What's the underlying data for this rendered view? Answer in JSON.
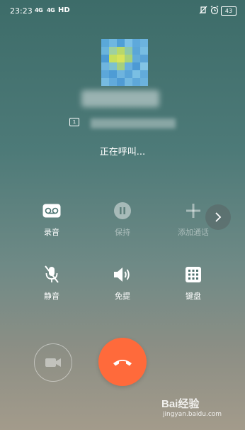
{
  "status_bar": {
    "time": "23:23",
    "signal_1": "4G",
    "signal_2": "4G",
    "network_type": "HD",
    "battery": "43"
  },
  "contact": {
    "sim_slot": "1"
  },
  "call": {
    "status_text": "正在呼叫..."
  },
  "controls": {
    "record_label": "录音",
    "hold_label": "保持",
    "add_call_label": "添加通话",
    "mute_label": "静音",
    "speaker_label": "免提",
    "keypad_label": "键盘"
  },
  "watermark": {
    "brand": "Bai经验",
    "url": "jingyan.baidu.com"
  },
  "colors": {
    "end_call": "#ff6a3b",
    "background_top": "#3d6c69",
    "background_bottom": "#a39b8b"
  }
}
